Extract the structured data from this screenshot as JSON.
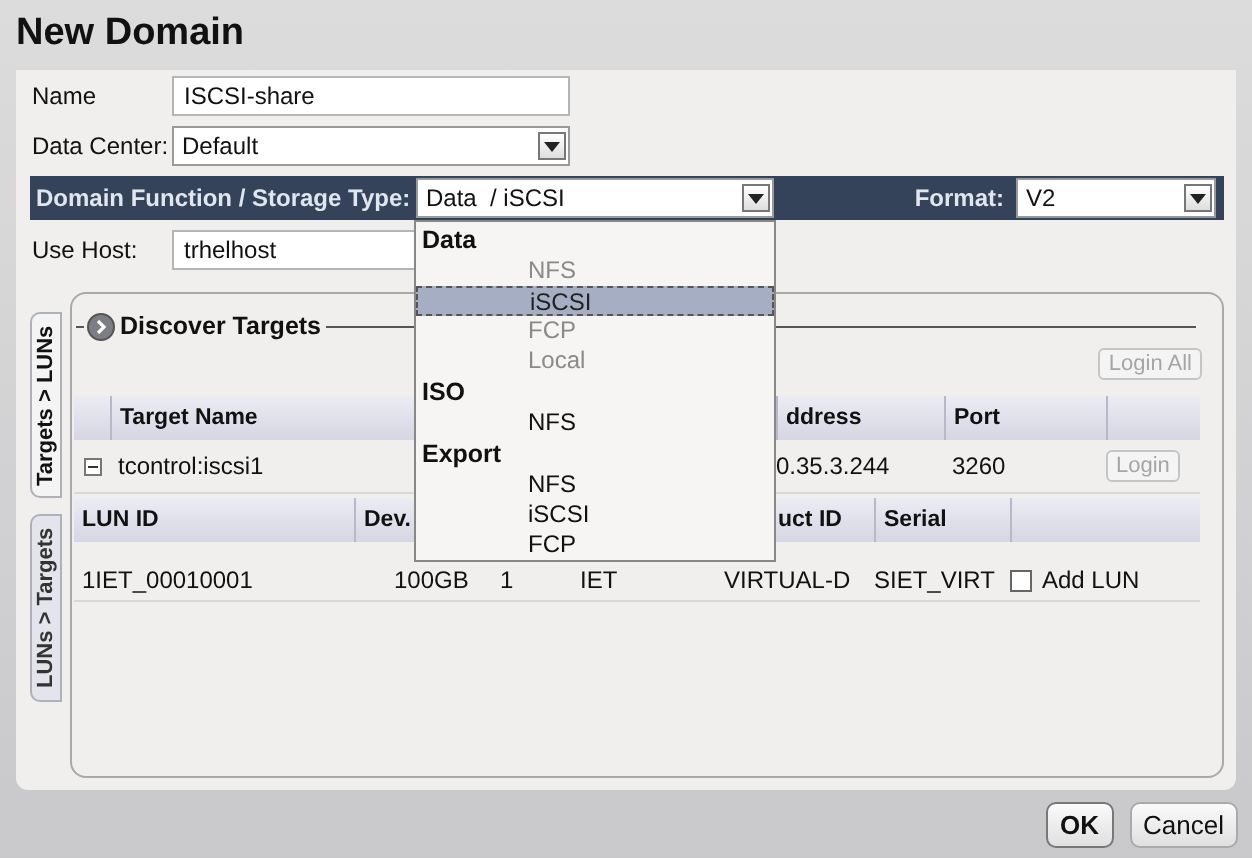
{
  "window": {
    "title": "New Domain"
  },
  "fields": [
    {
      "kind": "text",
      "label": "Name",
      "value": "ISCSI-share"
    },
    {
      "kind": "select",
      "label": "Data Center:",
      "value": "Default"
    }
  ],
  "function_bar": {
    "label": "Domain Function / Storage Type:",
    "value": "Data  / iSCSI",
    "format_label": "Format:",
    "format_value": "V2"
  },
  "use_host": {
    "label": "Use Host:",
    "value": "trhelhost"
  },
  "dropdown": {
    "groups": [
      {
        "label": "Data",
        "options": [
          {
            "label": "NFS",
            "disabled": true,
            "selected": false
          },
          {
            "label": "iSCSI",
            "disabled": false,
            "selected": true
          },
          {
            "label": "FCP",
            "disabled": true,
            "selected": false
          },
          {
            "label": "Local",
            "disabled": true,
            "selected": false
          }
        ]
      },
      {
        "label": "ISO",
        "options": [
          {
            "label": "NFS",
            "disabled": false,
            "selected": false
          }
        ]
      },
      {
        "label": "Export",
        "options": [
          {
            "label": "NFS",
            "disabled": false,
            "selected": false
          },
          {
            "label": "iSCSI",
            "disabled": false,
            "selected": false
          },
          {
            "label": "FCP",
            "disabled": false,
            "selected": false
          }
        ]
      }
    ]
  },
  "side_tabs": [
    {
      "label": "Targets > LUNs",
      "selected": true
    },
    {
      "label": "LUNs > Targets",
      "selected": false
    }
  ],
  "discover": {
    "title": "Discover Targets",
    "login_all": "Login All"
  },
  "targets_table": {
    "columns": [
      "Target Name",
      "ddress",
      "Port"
    ],
    "rows": [
      {
        "expanded": true,
        "name": "tcontrol:iscsi1",
        "address": "0.35.3.244",
        "port": "3260",
        "action": "Login",
        "action_disabled": true
      }
    ]
  },
  "luns_table": {
    "columns": [
      "LUN ID",
      "Dev.",
      "",
      "",
      "uct ID",
      "Serial"
    ],
    "rows": [
      {
        "cells": [
          "1IET_00010001",
          "100GB",
          "1",
          "IET",
          "VIRTUAL-D",
          "SIET_VIRT"
        ],
        "add_lun": false,
        "add_label": "Add LUN"
      }
    ]
  },
  "buttons": [
    {
      "label": "OK",
      "default": true
    },
    {
      "label": "Cancel",
      "default": false
    }
  ]
}
